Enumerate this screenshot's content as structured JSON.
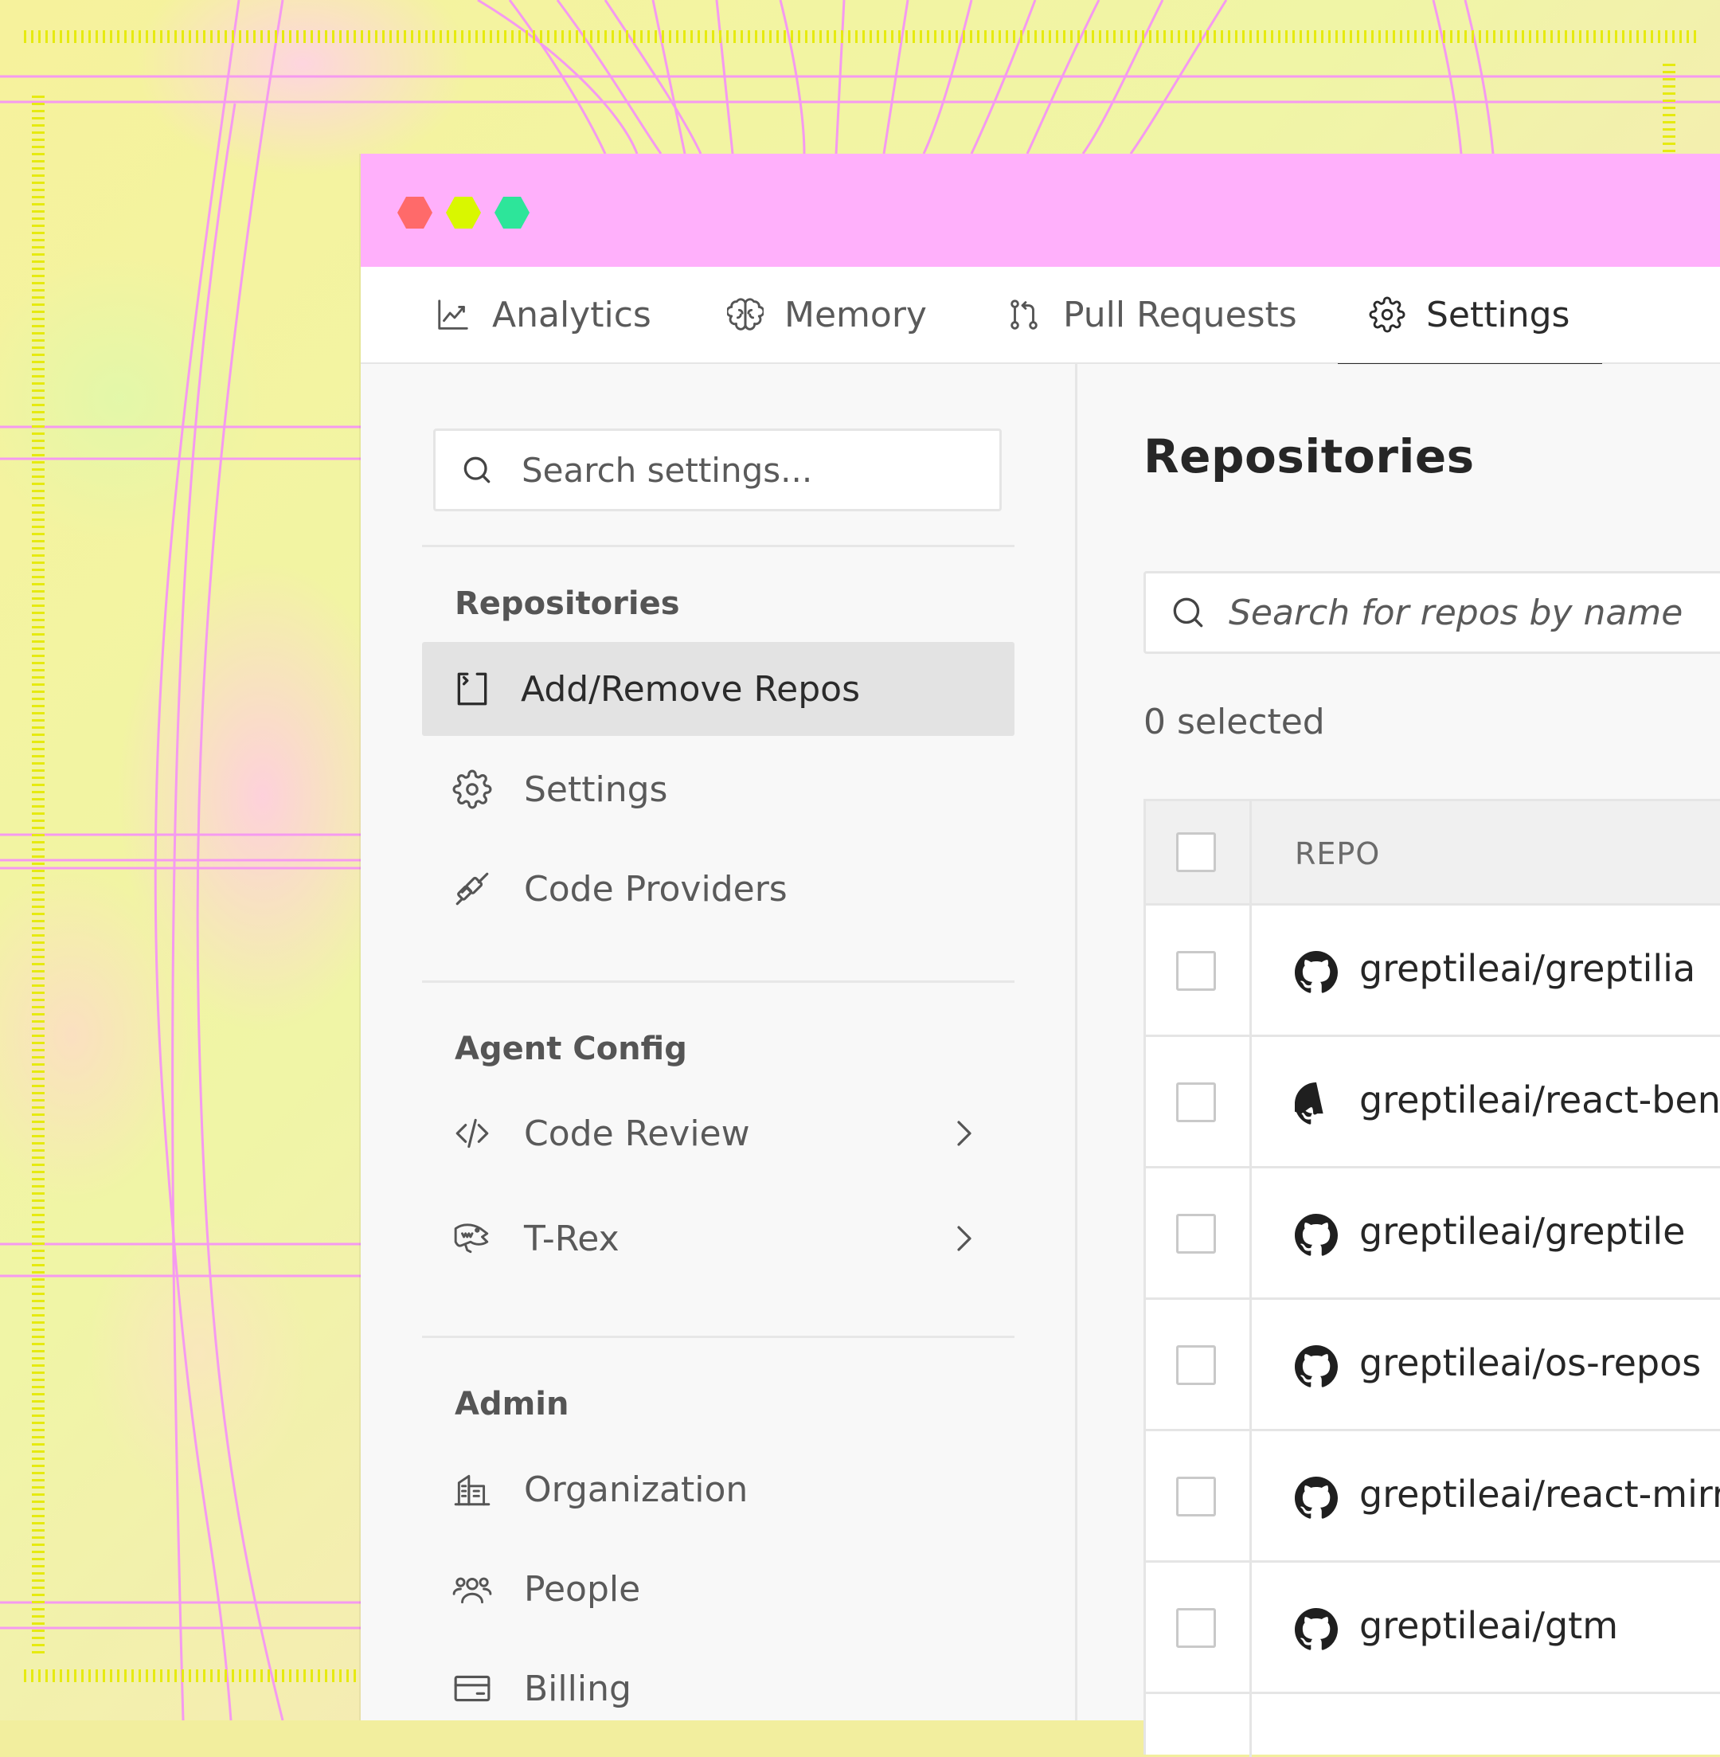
{
  "window": {
    "traffic_lights": [
      "#ff6a6a",
      "#d9f700",
      "#2de59a"
    ]
  },
  "tabs": [
    {
      "label": "Analytics",
      "icon": "chart-line-icon",
      "active": false
    },
    {
      "label": "Memory",
      "icon": "brain-icon",
      "active": false
    },
    {
      "label": "Pull Requests",
      "icon": "git-pull-request-icon",
      "active": false
    },
    {
      "label": "Settings",
      "icon": "gear-icon",
      "active": true
    }
  ],
  "sidebar": {
    "search_placeholder": "Search settings...",
    "sections": [
      {
        "title": "Repositories",
        "items": [
          {
            "label": "Add/Remove Repos",
            "icon": "repo-bracket-icon",
            "active": true
          },
          {
            "label": "Settings",
            "icon": "gear-icon",
            "active": false
          },
          {
            "label": "Code Providers",
            "icon": "plug-icon",
            "active": false
          }
        ]
      },
      {
        "title": "Agent Config",
        "items": [
          {
            "label": "Code Review",
            "icon": "code-icon",
            "has_submenu": true
          },
          {
            "label": "T-Rex",
            "icon": "dinosaur-icon",
            "has_submenu": true
          }
        ]
      },
      {
        "title": "Admin",
        "items": [
          {
            "label": "Organization",
            "icon": "building-icon"
          },
          {
            "label": "People",
            "icon": "people-icon"
          },
          {
            "label": "Billing",
            "icon": "credit-card-icon"
          }
        ]
      }
    ]
  },
  "main": {
    "title": "Repositories",
    "search_placeholder": "Search for repos by name",
    "selected_text": "0 selected",
    "table": {
      "header": "REPO",
      "rows": [
        "greptileai/greptilia",
        "greptileai/react-benc",
        "greptileai/greptile",
        "greptileai/os-repos",
        "greptileai/react-mirro",
        "greptileai/gtm"
      ]
    }
  }
}
